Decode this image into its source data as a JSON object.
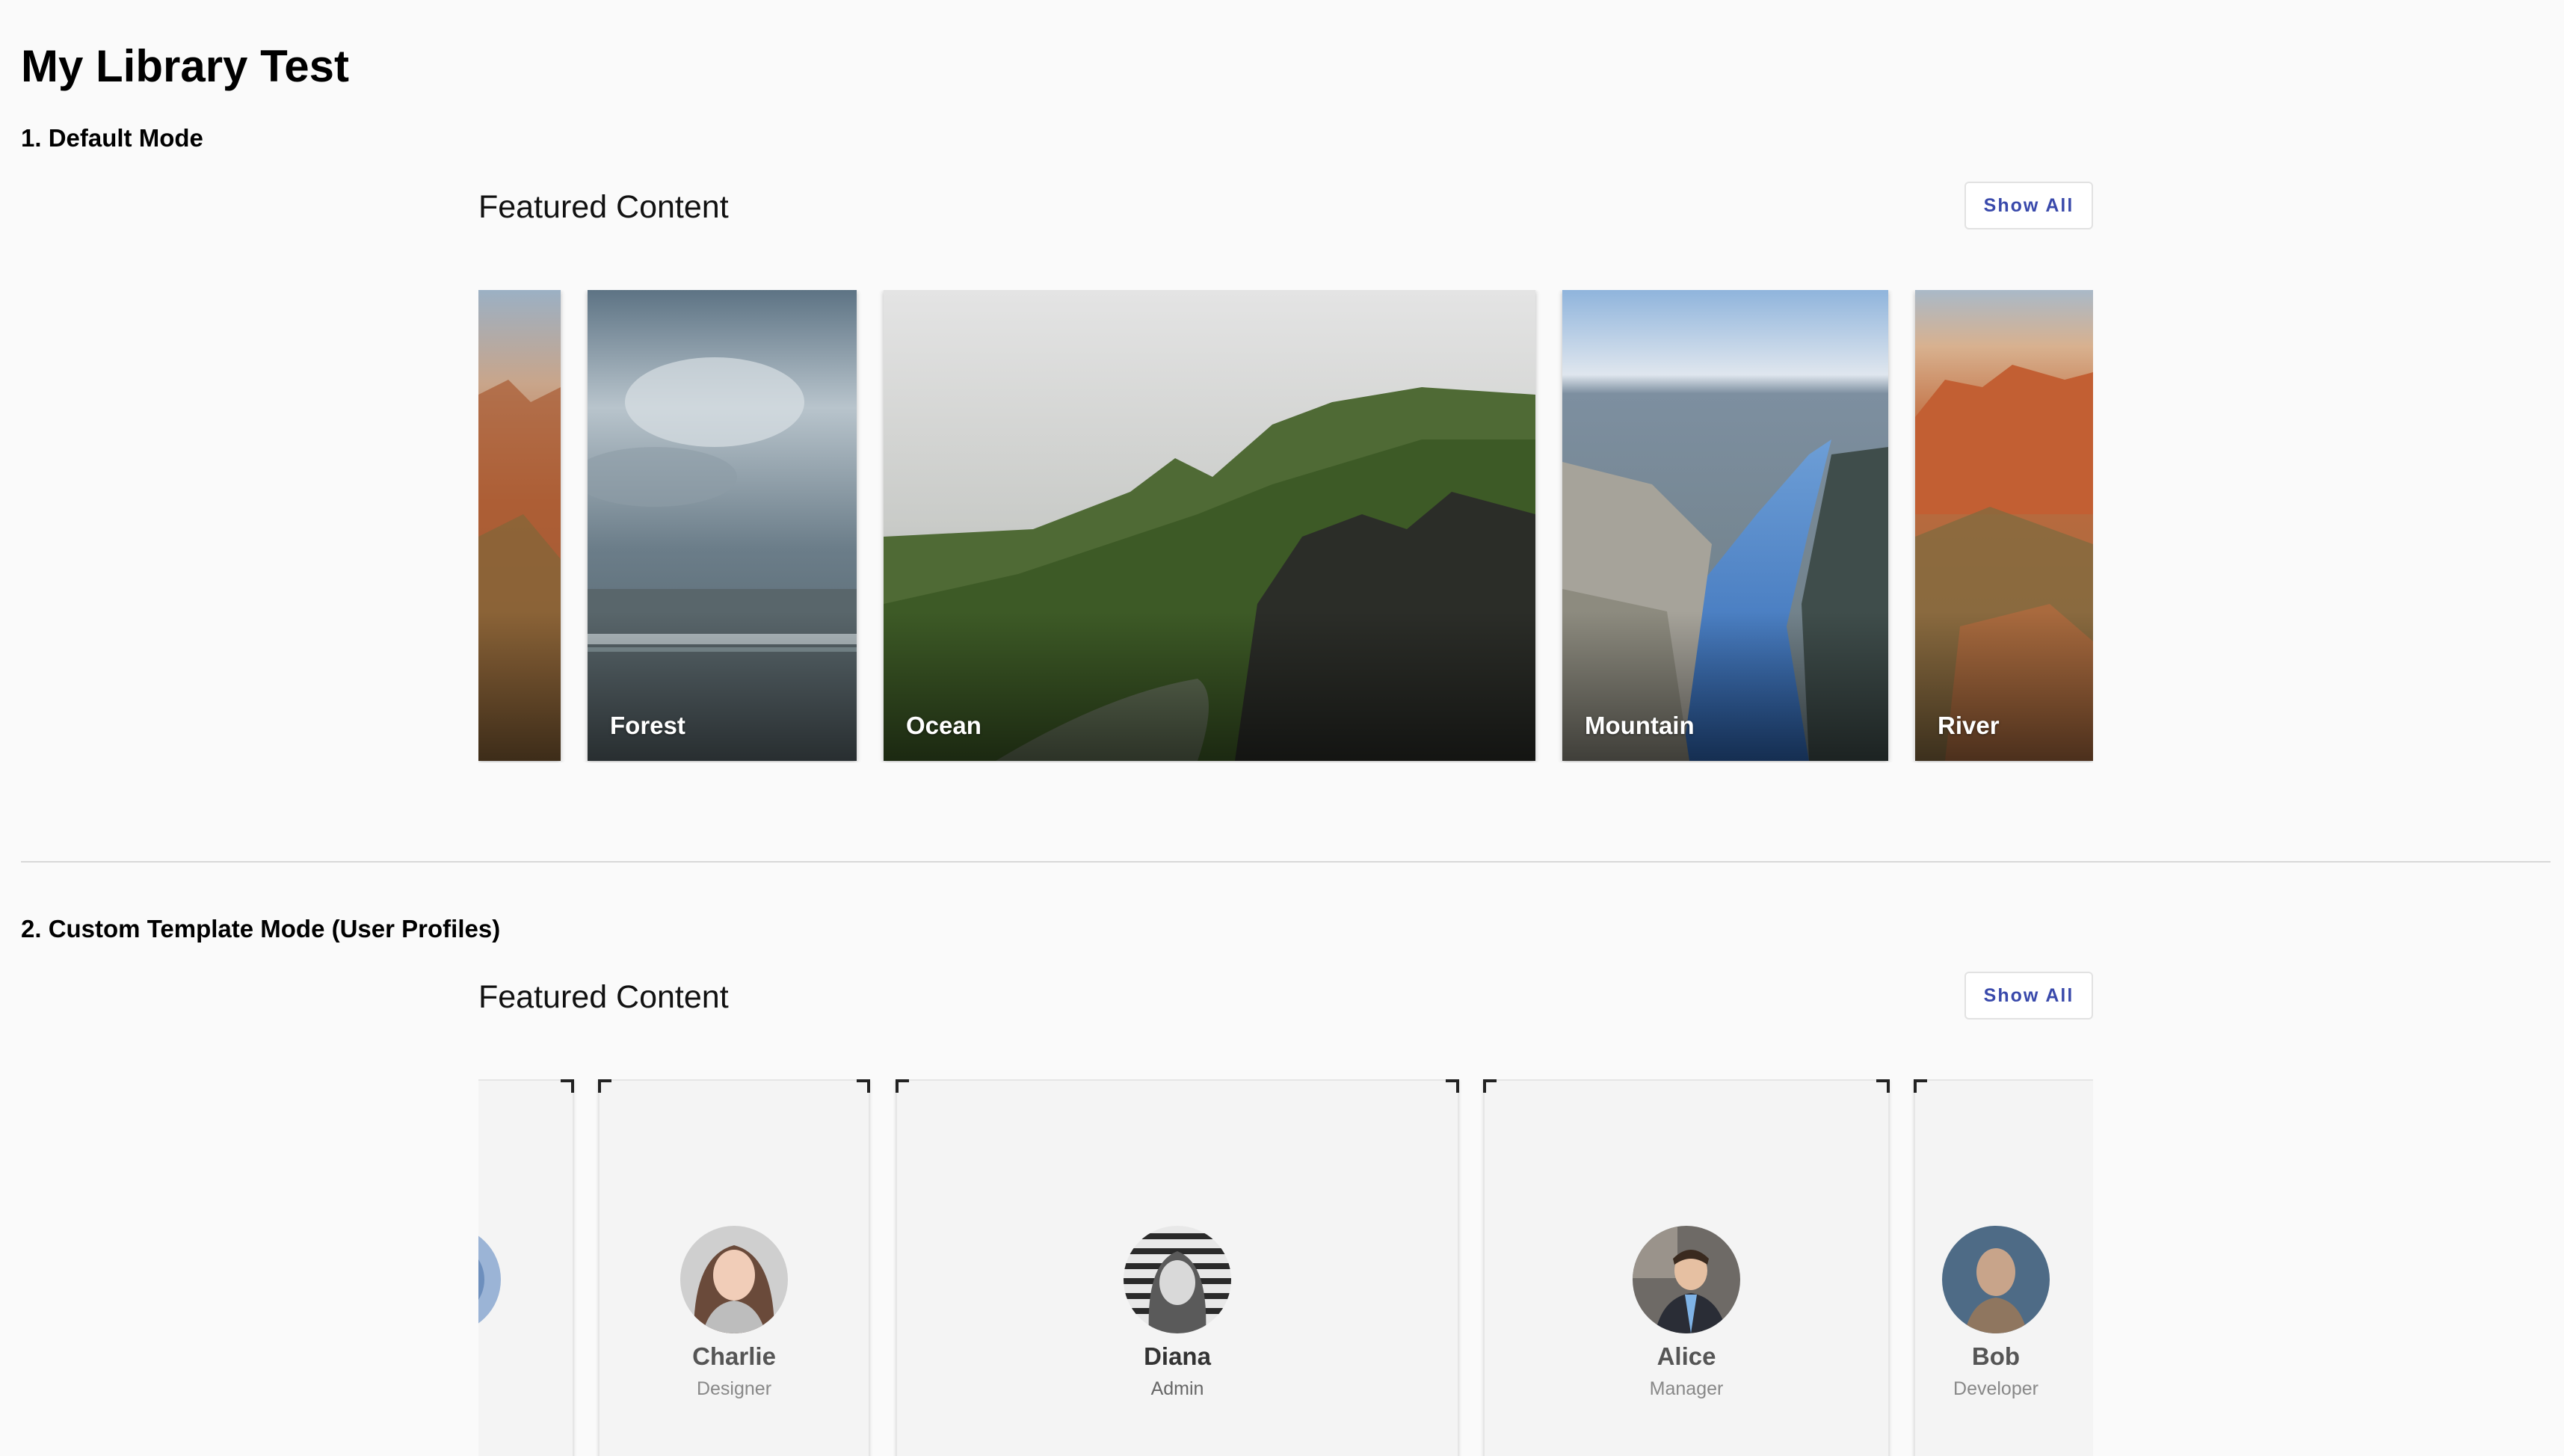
{
  "page": {
    "title": "My Library Test"
  },
  "sections": [
    {
      "heading": "1. Default Mode"
    },
    {
      "heading": "2. Custom Template Mode (User Profiles)"
    }
  ],
  "carousel_default": {
    "title": "Featured Content",
    "show_all_label": "Show All",
    "items": [
      {
        "label": "Forest",
        "image": "stormy-sky-sea"
      },
      {
        "label": "Ocean",
        "image": "green-cliffs-valley"
      },
      {
        "label": "Mountain",
        "image": "fjord-river"
      },
      {
        "label": "River",
        "image": "red-rock-canyon"
      }
    ]
  },
  "carousel_profiles": {
    "title": "Featured Content",
    "show_all_label": "Show All",
    "profiles": [
      {
        "name": "Charlie",
        "role": "Designer"
      },
      {
        "name": "Diana",
        "role": "Admin"
      },
      {
        "name": "Alice",
        "role": "Manager"
      },
      {
        "name": "Bob",
        "role": "Developer"
      }
    ]
  }
}
